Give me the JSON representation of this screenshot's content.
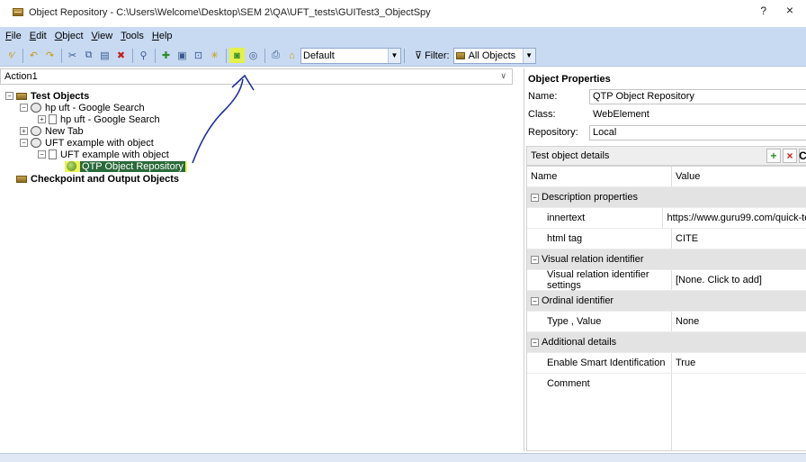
{
  "window": {
    "title": "Object Repository - C:\\Users\\Welcome\\Desktop\\SEM 2\\QA\\UFT_tests\\GUITest3_ObjectSpy",
    "help": "?",
    "close": "×"
  },
  "menu": {
    "items": [
      {
        "u": "F",
        "rest": "ile"
      },
      {
        "u": "E",
        "rest": "dit"
      },
      {
        "u": "O",
        "rest": "bject"
      },
      {
        "u": "V",
        "rest": "iew"
      },
      {
        "u": "T",
        "rest": "ools"
      },
      {
        "u": "H",
        "rest": "elp"
      }
    ]
  },
  "toolbar": {
    "env_combo": "Default",
    "filter_label": "Filter:",
    "filter_combo": "All Objects"
  },
  "left": {
    "action": "Action1",
    "tree": {
      "test_objects": "Test Objects",
      "hp_uft_browser": "hp uft - Google Search",
      "hp_uft_page": "hp uft - Google Search",
      "new_tab": "New Tab",
      "uft_example_browser": "UFT example with object",
      "uft_example_page": "UFT example with object",
      "qtp_repo": "QTP Object Repository",
      "checkpoints": "Checkpoint and Output Objects"
    }
  },
  "properties": {
    "title": "Object Properties",
    "name_label": "Name:",
    "name_value": "QTP Object Repository",
    "class_label": "Class:",
    "class_value": "WebElement",
    "repository_label": "Repository:",
    "repository_value": "Local",
    "details_label": "Test object details",
    "col_name": "Name",
    "col_value": "Value",
    "sections": {
      "description": "Description properties",
      "visual": "Visual relation identifier",
      "ordinal": "Ordinal identifier",
      "additional": "Additional details"
    },
    "rows": {
      "innertext_name": "innertext",
      "innertext_value": "https://www.guru99.com/quick-te...",
      "htmltag_name": "html tag",
      "htmltag_value": "CITE",
      "vri_name": "Visual relation identifier settings",
      "vri_value": "[None. Click to add]",
      "type_name": "Type , Value",
      "type_value": "None",
      "smart_name": "Enable Smart Identification",
      "smart_value": "True",
      "comment_name": "Comment",
      "comment_value": ""
    }
  }
}
